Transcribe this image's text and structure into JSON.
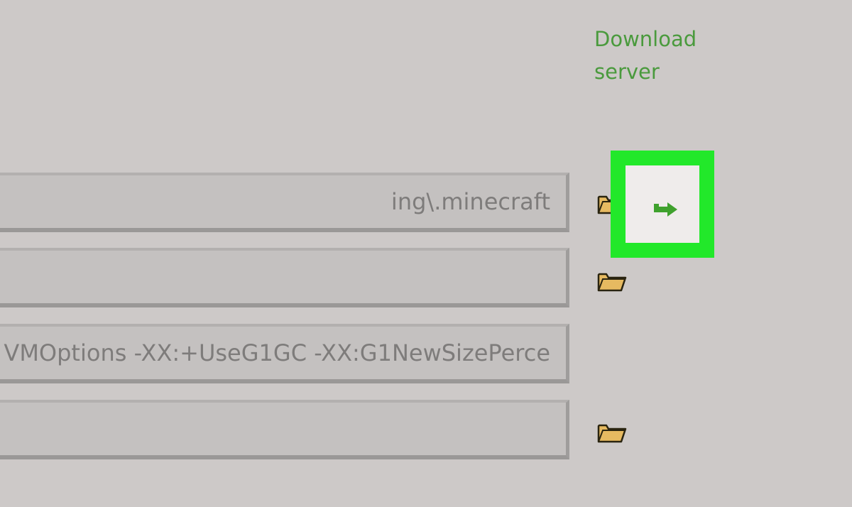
{
  "links": {
    "download_server": "Download server"
  },
  "fields": [
    {
      "value": "ing\\.minecraft"
    },
    {
      "value": ""
    },
    {
      "value": "VMOptions -XX:+UseG1GC -XX:G1NewSizePerce"
    },
    {
      "value": ""
    }
  ],
  "icons": {
    "folder": "folder-icon",
    "open_directory": "arrow-right-icon"
  },
  "colors": {
    "link_green": "#4a9a3d",
    "highlight_green": "#22e82a",
    "folder_yellow": "#e6ba61",
    "arrow_green": "#3fa12d"
  }
}
